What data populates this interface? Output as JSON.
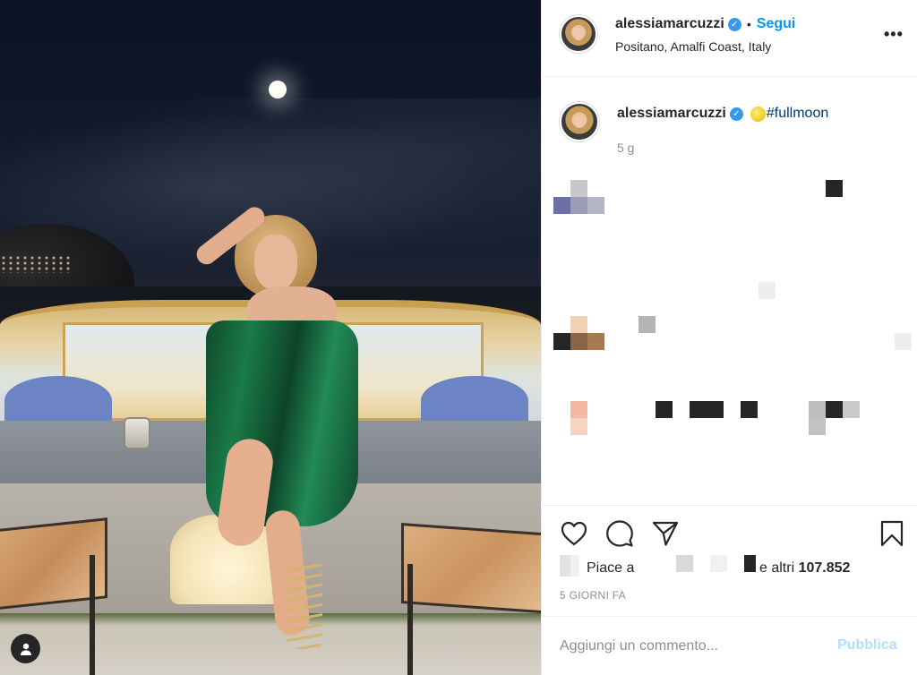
{
  "post": {
    "photo_alt": "Photo by alessiamarcuzzi"
  },
  "header": {
    "username": "alessiamarcuzzi",
    "verified_icon": "verified-badge-icon",
    "separator": "•",
    "follow_label": "Segui",
    "location": "Positano, Amalfi Coast, Italy",
    "more_icon": "more-options-icon",
    "more_label": "•••"
  },
  "caption": {
    "username": "alessiamarcuzzi",
    "emoji": "full-moon-emoji",
    "hashtag": "#fullmoon",
    "time": "5 g"
  },
  "actions": {
    "like_icon": "heart-icon",
    "comment_icon": "comment-icon",
    "share_icon": "paper-plane-icon",
    "save_icon": "bookmark-icon",
    "likes_prefix": "Piace a",
    "likes_suffix": "e altri",
    "likes_count": "107.852",
    "date": "5 GIORNI FA"
  },
  "comment": {
    "placeholder": "Aggiungi un commento...",
    "publish_label": "Pubblica"
  },
  "colors": {
    "link_blue": "#0095f6",
    "publish_disabled": "#b2dffc",
    "text_primary": "#262626",
    "text_secondary": "#8e8e8e",
    "verified_blue": "#3897f0"
  }
}
